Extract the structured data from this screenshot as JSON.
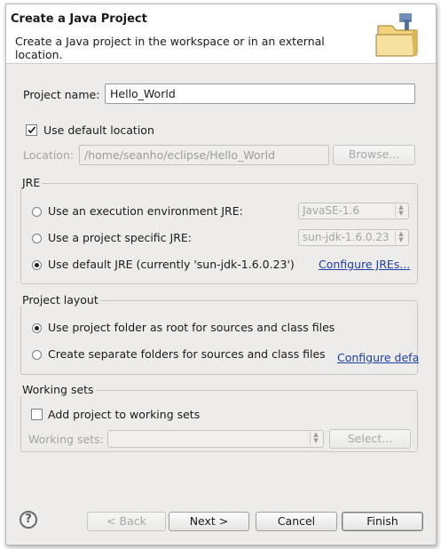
{
  "header": {
    "title": "Create a Java Project",
    "description": "Create a Java project in the workspace or in an external location."
  },
  "project": {
    "name_label": "Project name:",
    "name_value": "Hello_World",
    "use_default_label": "Use default location",
    "use_default_checked": true,
    "location_label": "Location:",
    "location_value": "/home/seanho/eclipse/Hello_World",
    "browse_label": "Browse..."
  },
  "jre": {
    "group_label": "JRE",
    "options": [
      {
        "label": "Use an execution environment JRE:",
        "selected": false,
        "combo": "JavaSE-1.6"
      },
      {
        "label": "Use a project specific JRE:",
        "selected": false,
        "combo": "sun-jdk-1.6.0.23"
      },
      {
        "label": "Use default JRE (currently 'sun-jdk-1.6.0.23')",
        "selected": true
      }
    ],
    "configure_link": "Configure JREs..."
  },
  "layout": {
    "group_label": "Project layout",
    "options": [
      {
        "label": "Use project folder as root for sources and class files",
        "selected": true
      },
      {
        "label": "Create separate folders for sources and class files",
        "selected": false
      }
    ],
    "configure_link": "Configure defa"
  },
  "working_sets": {
    "group_label": "Working sets",
    "add_label": "Add project to working sets",
    "add_checked": false,
    "sets_label": "Working sets:",
    "sets_value": "",
    "select_label": "Select..."
  },
  "buttons": {
    "help": "?",
    "back": "< Back",
    "next": "Next >",
    "cancel": "Cancel",
    "finish": "Finish"
  },
  "colors": {
    "link": "#1e3da6",
    "window_bg": "#edeceb",
    "header_bg": "#ffffff"
  },
  "icons": {
    "wizard": "new-java-project-folder-icon",
    "help": "help-icon"
  }
}
